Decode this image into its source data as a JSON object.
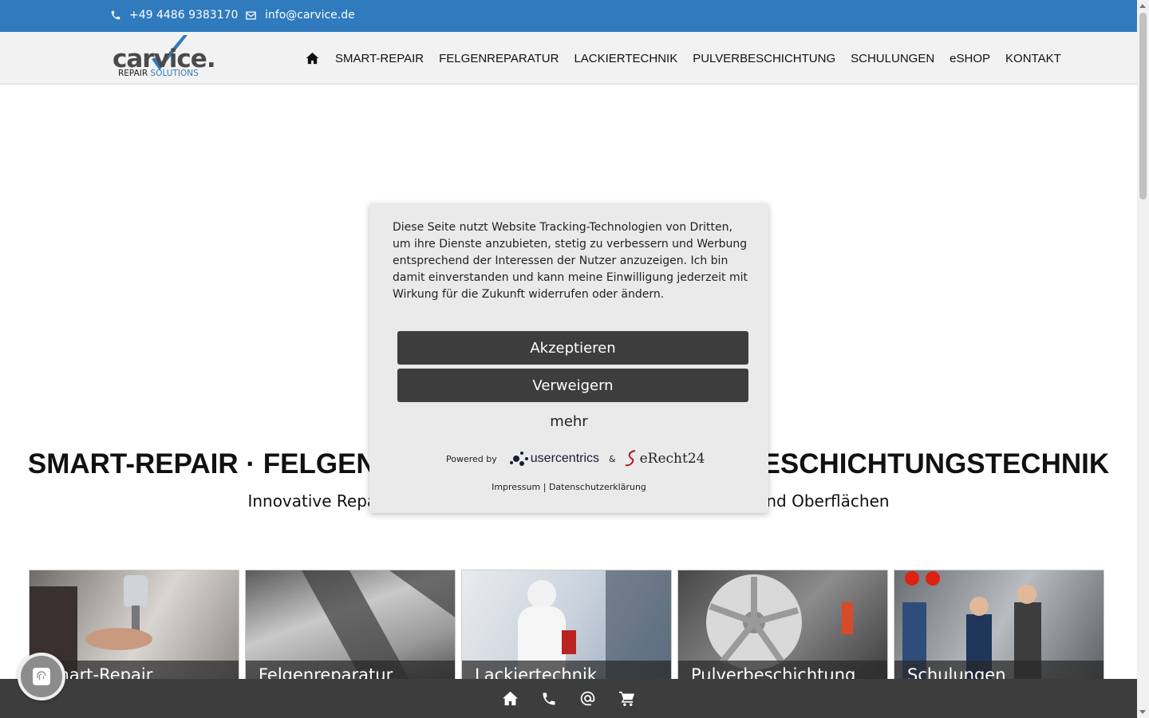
{
  "topbar": {
    "phone": "+49 4486 9383170",
    "email": "info@carvice.de"
  },
  "logo": {
    "word": "carvice.",
    "sub_repair": "REPAIR",
    "sub_solutions": "SOLUTIONS"
  },
  "nav": {
    "home_icon": "home-icon",
    "items": [
      "SMART-REPAIR",
      "FELGENREPARATUR",
      "LACKIERTECHNIK",
      "PULVERBESCHICHTUNG",
      "SCHULUNGEN",
      "eSHOP",
      "KONTAKT"
    ]
  },
  "hero": {
    "title": "SMART-REPAIR · FELGENREPARATUR · LACKIER- & BESCHICHTUNGSTECHNIK",
    "subtitle": "Innovative Reparatur- und Beschichtungstechnik für Fahrzeuge und Oberflächen"
  },
  "tiles": [
    "Smart-Repair",
    "Felgenreparatur",
    "Lackiertechnik",
    "Pulverbeschichtung",
    "Schulungen"
  ],
  "consent": {
    "text": "Diese Seite nutzt Website Tracking-Technologien von Dritten, um ihre Dienste anzubieten, stetig zu verbessern und Werbung entsprechend der Interessen der Nutzer anzuzeigen. Ich bin damit einverstanden und kann meine Einwilligung jederzeit mit Wirkung für die Zukunft widerrufen oder ändern.",
    "accept": "Akzeptieren",
    "deny": "Verweigern",
    "more": "mehr",
    "powered_by": "Powered by",
    "usercentrics": "usercentrics",
    "amp": "&",
    "erecht": "eRecht24",
    "impressum": "Impressum",
    "separator": "|",
    "privacy": "Datenschutzerklärung"
  },
  "bottombar": {
    "icons": [
      "home-icon",
      "phone-icon",
      "at-icon",
      "cart-icon"
    ]
  },
  "colors": {
    "brand_blue": "#2f7bbd",
    "dark": "#3d3d3d",
    "modal_bg": "#eaeaea"
  }
}
